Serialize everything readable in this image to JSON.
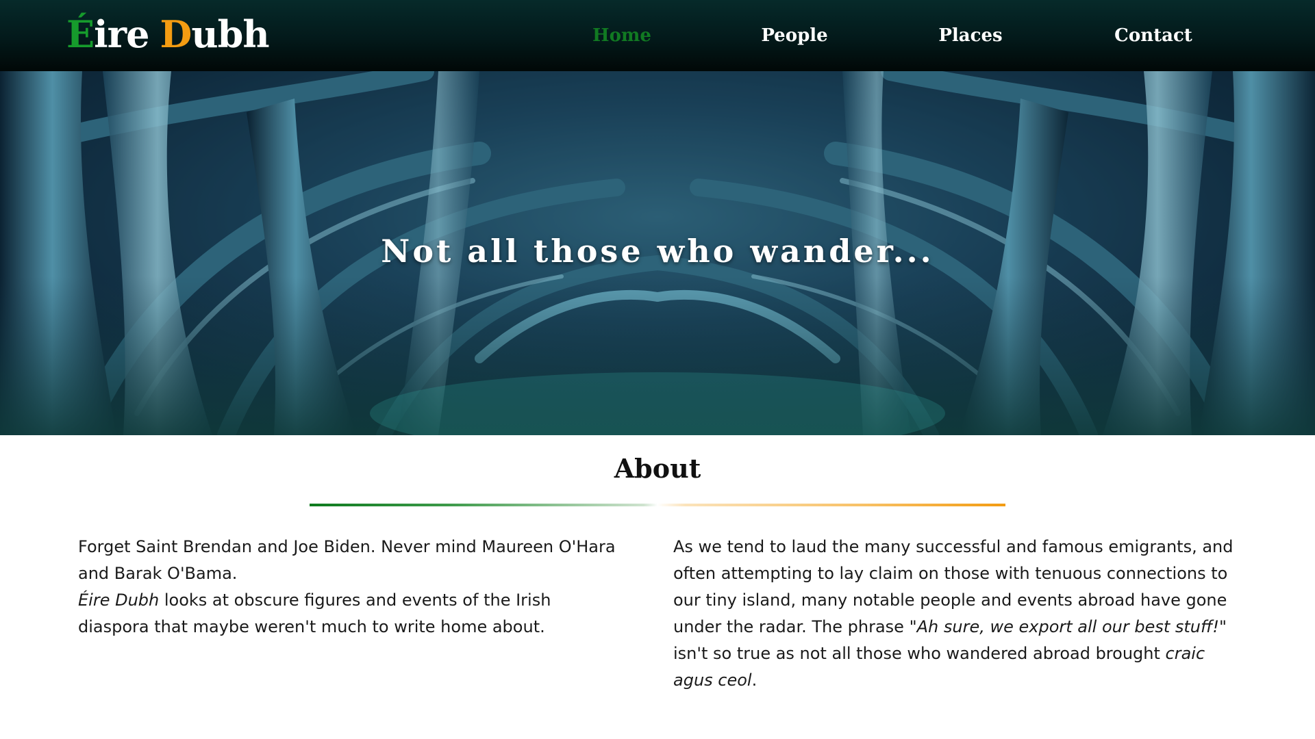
{
  "site": {
    "brand": {
      "word1": {
        "first": "É",
        "rest": "ire"
      },
      "word2": {
        "first": "D",
        "rest": "ubh"
      }
    },
    "colors": {
      "green": "#169b2c",
      "orange": "#f39c12",
      "nav_active": "#117a22",
      "nav_bg": "#031f1f"
    }
  },
  "nav": {
    "items": [
      {
        "label": "Home",
        "active": true
      },
      {
        "label": "People",
        "active": false
      },
      {
        "label": "Places",
        "active": false
      },
      {
        "label": "Contact",
        "active": false
      }
    ]
  },
  "hero": {
    "title": "Not all those who wander..."
  },
  "about": {
    "heading": "About",
    "left": {
      "line1": "Forget Saint Brendan and Joe Biden. Never mind Maureen O'Hara and Barak O'Bama.",
      "name_italic": "Éire Dubh",
      "line2_rest": " looks at obscure figures and events of the Irish diaspora that maybe weren't much to write home about."
    },
    "right": {
      "part1": "As we tend to laud the many successful and famous emigrants, and often attempting to lay claim on those with tenuous connections to our tiny island, many notable people and events abroad have gone under the radar. The phrase ",
      "quote_italic": "\"Ah sure, we export all our best stuff!\"",
      "part2": " isn't so true as not all those who wandered abroad brought ",
      "craic_italic": "craic agus ceol",
      "part3": "."
    }
  }
}
